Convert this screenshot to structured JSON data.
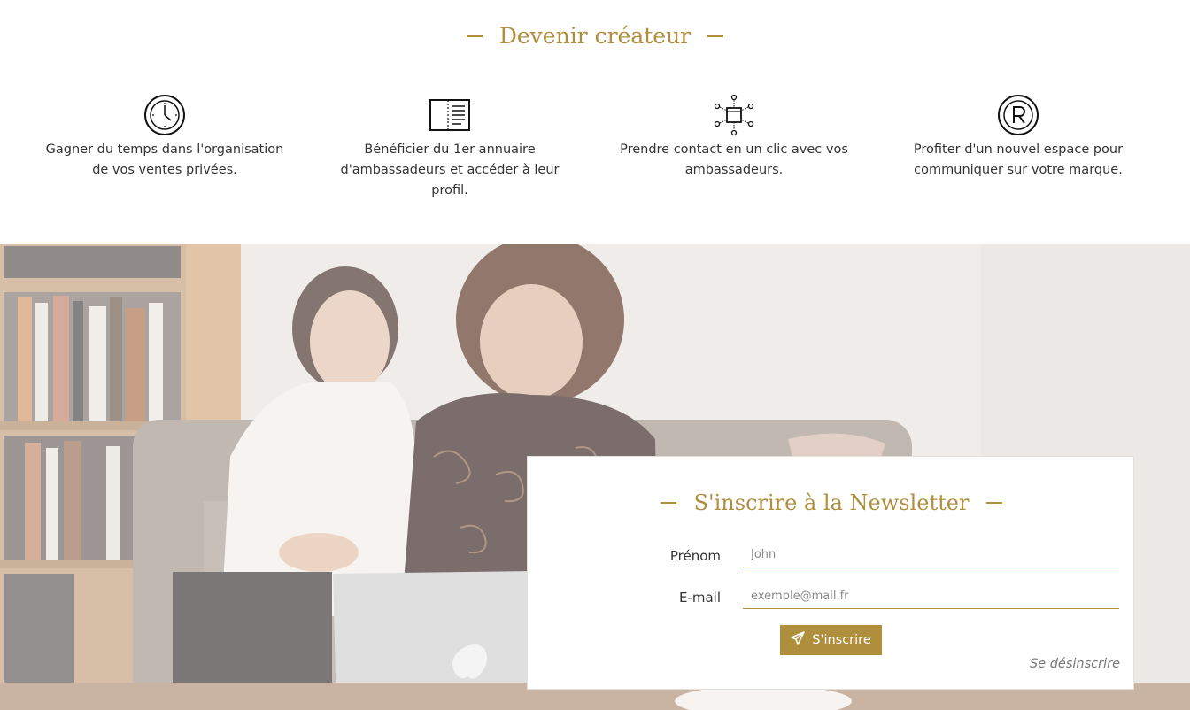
{
  "section": {
    "title": "Devenir créateur",
    "features": [
      {
        "icon": "clock-icon",
        "text": "Gagner du temps dans l'organisation de vos ventes privées."
      },
      {
        "icon": "notebook-icon",
        "text": "Bénéficier du 1er annuaire d'ambassadeurs et accéder à leur profil."
      },
      {
        "icon": "network-icon",
        "text": "Prendre contact en un clic avec vos ambassadeurs."
      },
      {
        "icon": "registered-mark-icon",
        "text": "Profiter d'un nouvel espace pour communiquer sur votre marque."
      }
    ]
  },
  "newsletter": {
    "title": "S'inscrire à la Newsletter",
    "first_name_label": "Prénom",
    "first_name_placeholder": "John",
    "email_label": "E-mail",
    "email_placeholder": "exemple@mail.fr",
    "submit_label": "S'inscrire",
    "unsubscribe_label": "Se désinscrire"
  },
  "colors": {
    "accent": "#b08f3c",
    "text": "#333333"
  }
}
